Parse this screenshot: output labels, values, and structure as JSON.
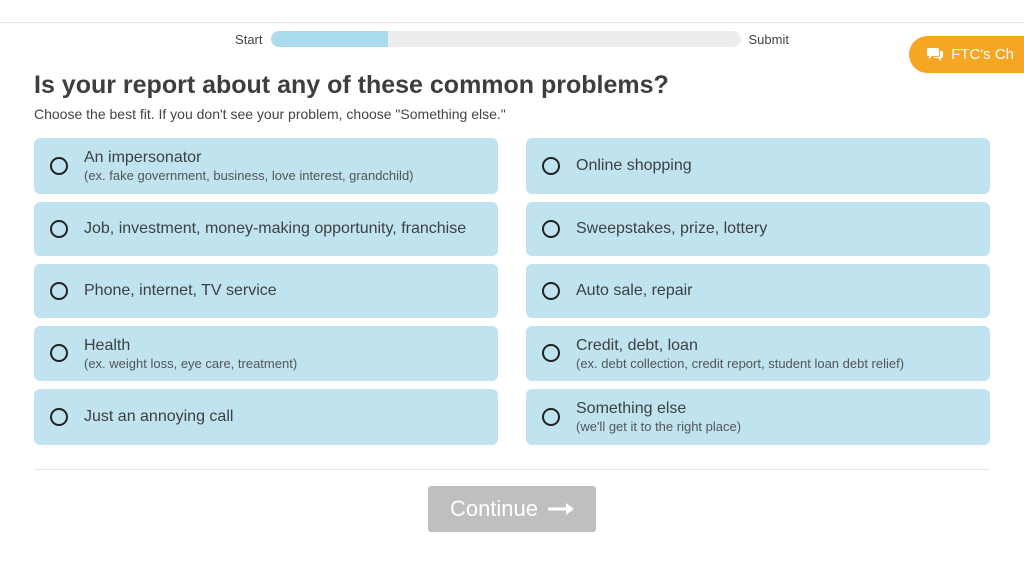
{
  "chat": {
    "label": "FTC's Ch"
  },
  "progress": {
    "start_label": "Start",
    "submit_label": "Submit"
  },
  "header": {
    "title": "Is your report about any of these common problems?",
    "subhead": "Choose the best fit. If you don't see your problem, choose \"Something else.\""
  },
  "options": {
    "o1": {
      "title": "An impersonator",
      "sub": "(ex. fake government, business, love interest, grandchild)"
    },
    "o2": {
      "title": "Online shopping",
      "sub": ""
    },
    "o3": {
      "title": "Job, investment, money-making opportunity, franchise",
      "sub": ""
    },
    "o4": {
      "title": "Sweepstakes, prize, lottery",
      "sub": ""
    },
    "o5": {
      "title": "Phone, internet, TV service",
      "sub": ""
    },
    "o6": {
      "title": "Auto sale, repair",
      "sub": ""
    },
    "o7": {
      "title": "Health",
      "sub": "(ex. weight loss, eye care, treatment)"
    },
    "o8": {
      "title": "Credit, debt, loan",
      "sub": "(ex. debt collection, credit report, student loan debt relief)"
    },
    "o9": {
      "title": "Just an annoying call",
      "sub": ""
    },
    "o10": {
      "title": "Something else",
      "sub": "(we'll get it to the right place)"
    }
  },
  "continue": {
    "label": "Continue"
  }
}
